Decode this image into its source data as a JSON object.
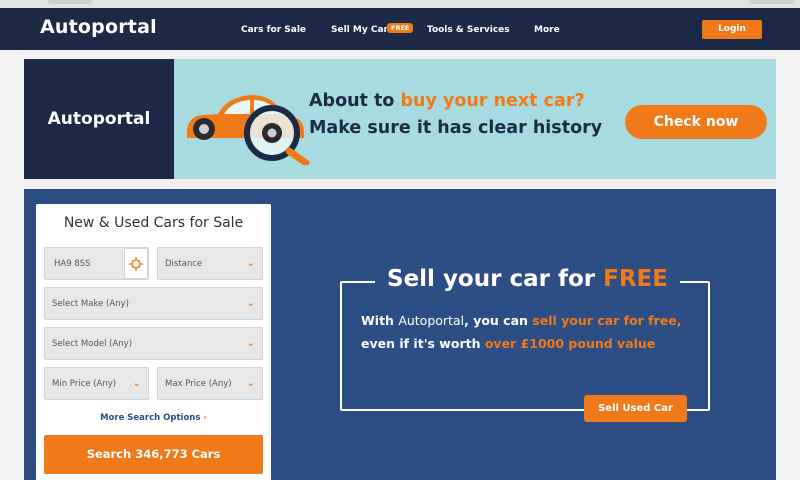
{
  "header": {
    "brand": "Autoportal",
    "nav": [
      "Cars for Sale",
      "Sell My Car",
      "Tools & Services",
      "More"
    ],
    "free_badge": "FREE",
    "login": "Login"
  },
  "banner": {
    "logo": "Autoportal",
    "line1_pre": "About to ",
    "line1_highlight": "buy your next car?",
    "line2": "Make sure it has clear history",
    "cta": "Check now"
  },
  "search": {
    "title": "New & Used Cars for Sale",
    "postcode": "HA9 8SS",
    "distance": "Distance",
    "make": "Select Make (Any)",
    "model": "Select Model (Any)",
    "min_price": "Min Price (Any)",
    "max_price": "Max Price (Any)",
    "more_options": "More Search Options",
    "button": "Search 346,773 Cars"
  },
  "sell": {
    "title_pre": "Sell your car for ",
    "title_highlight": "FREE",
    "line1_with": "With ",
    "line1_brand": "Autoportal",
    "line1_mid": ", you can ",
    "line1_highlight": "sell your car for free,",
    "line2_pre": "even if it's worth ",
    "line2_highlight": "over £1000 pound value",
    "button": "Sell Used Car"
  },
  "colors": {
    "navy": "#1c2a48",
    "accent": "#f07a1a",
    "hero_blue": "#2d4e85",
    "banner_teal": "#a8dbe0"
  },
  "icons": [
    "location-crosshair-icon",
    "chevron-down-icon",
    "chevron-right-icon",
    "car-magnifier-illustration"
  ]
}
